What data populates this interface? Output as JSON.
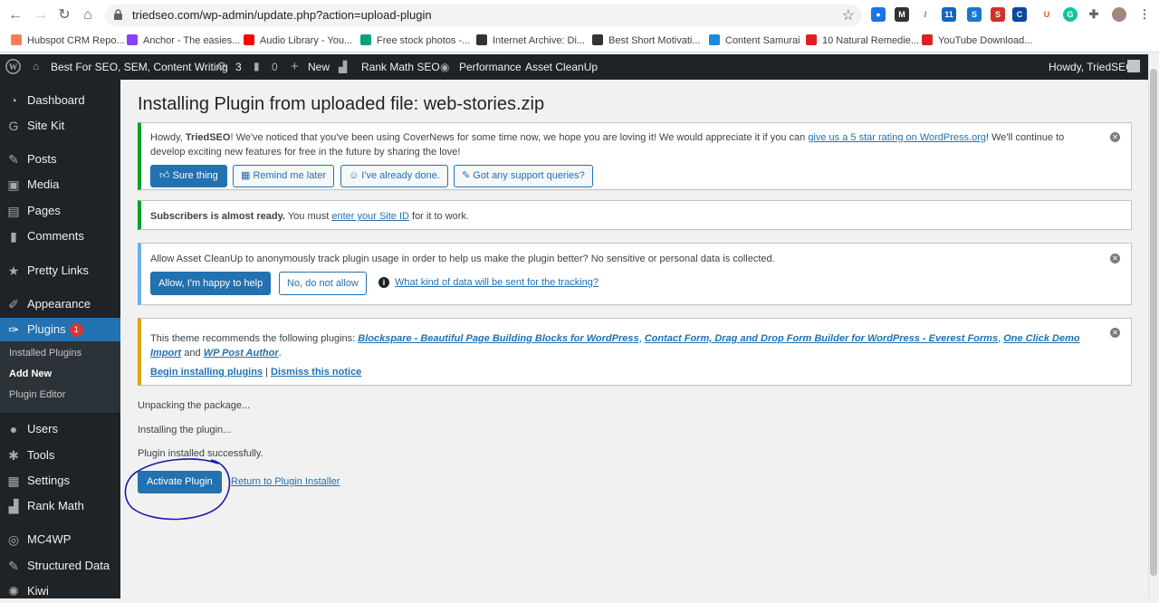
{
  "browser": {
    "url": "triedseo.com/wp-admin/update.php?action=upload-plugin",
    "bookmarks": [
      {
        "label": "Hubspot CRM Repo...",
        "color": "#ff7a59"
      },
      {
        "label": "Anchor - The easies...",
        "color": "#8940fa"
      },
      {
        "label": "Audio Library - You...",
        "color": "#ff0000"
      },
      {
        "label": "Free stock photos -...",
        "color": "#05a081"
      },
      {
        "label": "Internet Archive: Di...",
        "color": "#333333"
      },
      {
        "label": "Best Short Motivati...",
        "color": "#333333"
      },
      {
        "label": "Content Samurai",
        "color": "#1a8cd8"
      },
      {
        "label": "10 Natural Remedie...",
        "color": "#e02020"
      },
      {
        "label": "YouTube Download...",
        "color": "#e02020"
      }
    ]
  },
  "adminbar": {
    "site": "Best For SEO, SEM, Content Writing",
    "updates": "3",
    "comments": "0",
    "new": "New",
    "rankmath": "Rank Math SEO",
    "performance": "Performance",
    "assetcleanup": "Asset CleanUp",
    "howdy": "Howdy, TriedSEO"
  },
  "sidebar": {
    "items": [
      {
        "label": "Dashboard",
        "icon": "dashboard-icon"
      },
      {
        "label": "Site Kit",
        "icon": "google-icon"
      },
      {
        "label": "Posts",
        "icon": "pin-icon"
      },
      {
        "label": "Media",
        "icon": "media-icon"
      },
      {
        "label": "Pages",
        "icon": "page-icon"
      },
      {
        "label": "Comments",
        "icon": "comment-icon"
      },
      {
        "label": "Pretty Links",
        "icon": "star-icon"
      },
      {
        "label": "Appearance",
        "icon": "brush-icon"
      },
      {
        "label": "Plugins",
        "icon": "plugin-icon",
        "badge": "1"
      },
      {
        "label": "Users",
        "icon": "user-icon"
      },
      {
        "label": "Tools",
        "icon": "wrench-icon"
      },
      {
        "label": "Settings",
        "icon": "settings-icon"
      },
      {
        "label": "Rank Math",
        "icon": "chart-icon"
      },
      {
        "label": "MC4WP",
        "icon": "mc4wp-icon"
      },
      {
        "label": "Structured Data",
        "icon": "pin-icon"
      },
      {
        "label": "Kiwi",
        "icon": "kiwi-icon"
      }
    ],
    "submenu": [
      "Installed Plugins",
      "Add New",
      "Plugin Editor"
    ]
  },
  "main": {
    "title": "Installing Plugin from uploaded file: web-stories.zip",
    "covernews": {
      "text_a": "Howdy, ",
      "name": "TriedSEO",
      "text_b": "! We've noticed that you've been using CoverNews for some time now, we hope you are loving it! We would appreciate it if you can ",
      "link": "give us a 5 star rating on WordPress.org",
      "text_c": "! We'll continue to develop exciting new features for free in the future by sharing the love!",
      "btn_sure": "Sure thing",
      "btn_remind": "Remind me later",
      "btn_done": "I've already done.",
      "btn_support": "Got any support queries?"
    },
    "subscribers": {
      "bold": "Subscribers is almost ready.",
      "text_a": " You must ",
      "link": "enter your Site ID",
      "text_b": " for it to work."
    },
    "assetcleanup": {
      "text": "Allow Asset CleanUp to anonymously track plugin usage in order to help us make the plugin better? No sensitive or personal data is collected.",
      "btn_allow": "Allow, I'm happy to help",
      "btn_deny": "No, do not allow",
      "link": "What kind of data will be sent for the tracking?"
    },
    "theme": {
      "text_a": "This theme recommends the following plugins: ",
      "p1": "Blockspare - Beautiful Page Building Blocks for WordPress",
      "p2": "Contact Form, Drag and Drop Form Builder for WordPress - Everest Forms",
      "p3": "One Click Demo Import",
      "and": " and ",
      "p4": "WP Post Author",
      "begin": "Begin installing plugins",
      "sep": " | ",
      "dismiss": "Dismiss this notice"
    },
    "log": [
      "Unpacking the package...",
      "Installing the plugin...",
      "Plugin installed successfully."
    ],
    "activate": "Activate Plugin",
    "return": "Return to Plugin Installer"
  },
  "colors": {
    "accent": "#2271b1",
    "adminbar": "#1d2327",
    "annotation": "#1a1aa8"
  }
}
